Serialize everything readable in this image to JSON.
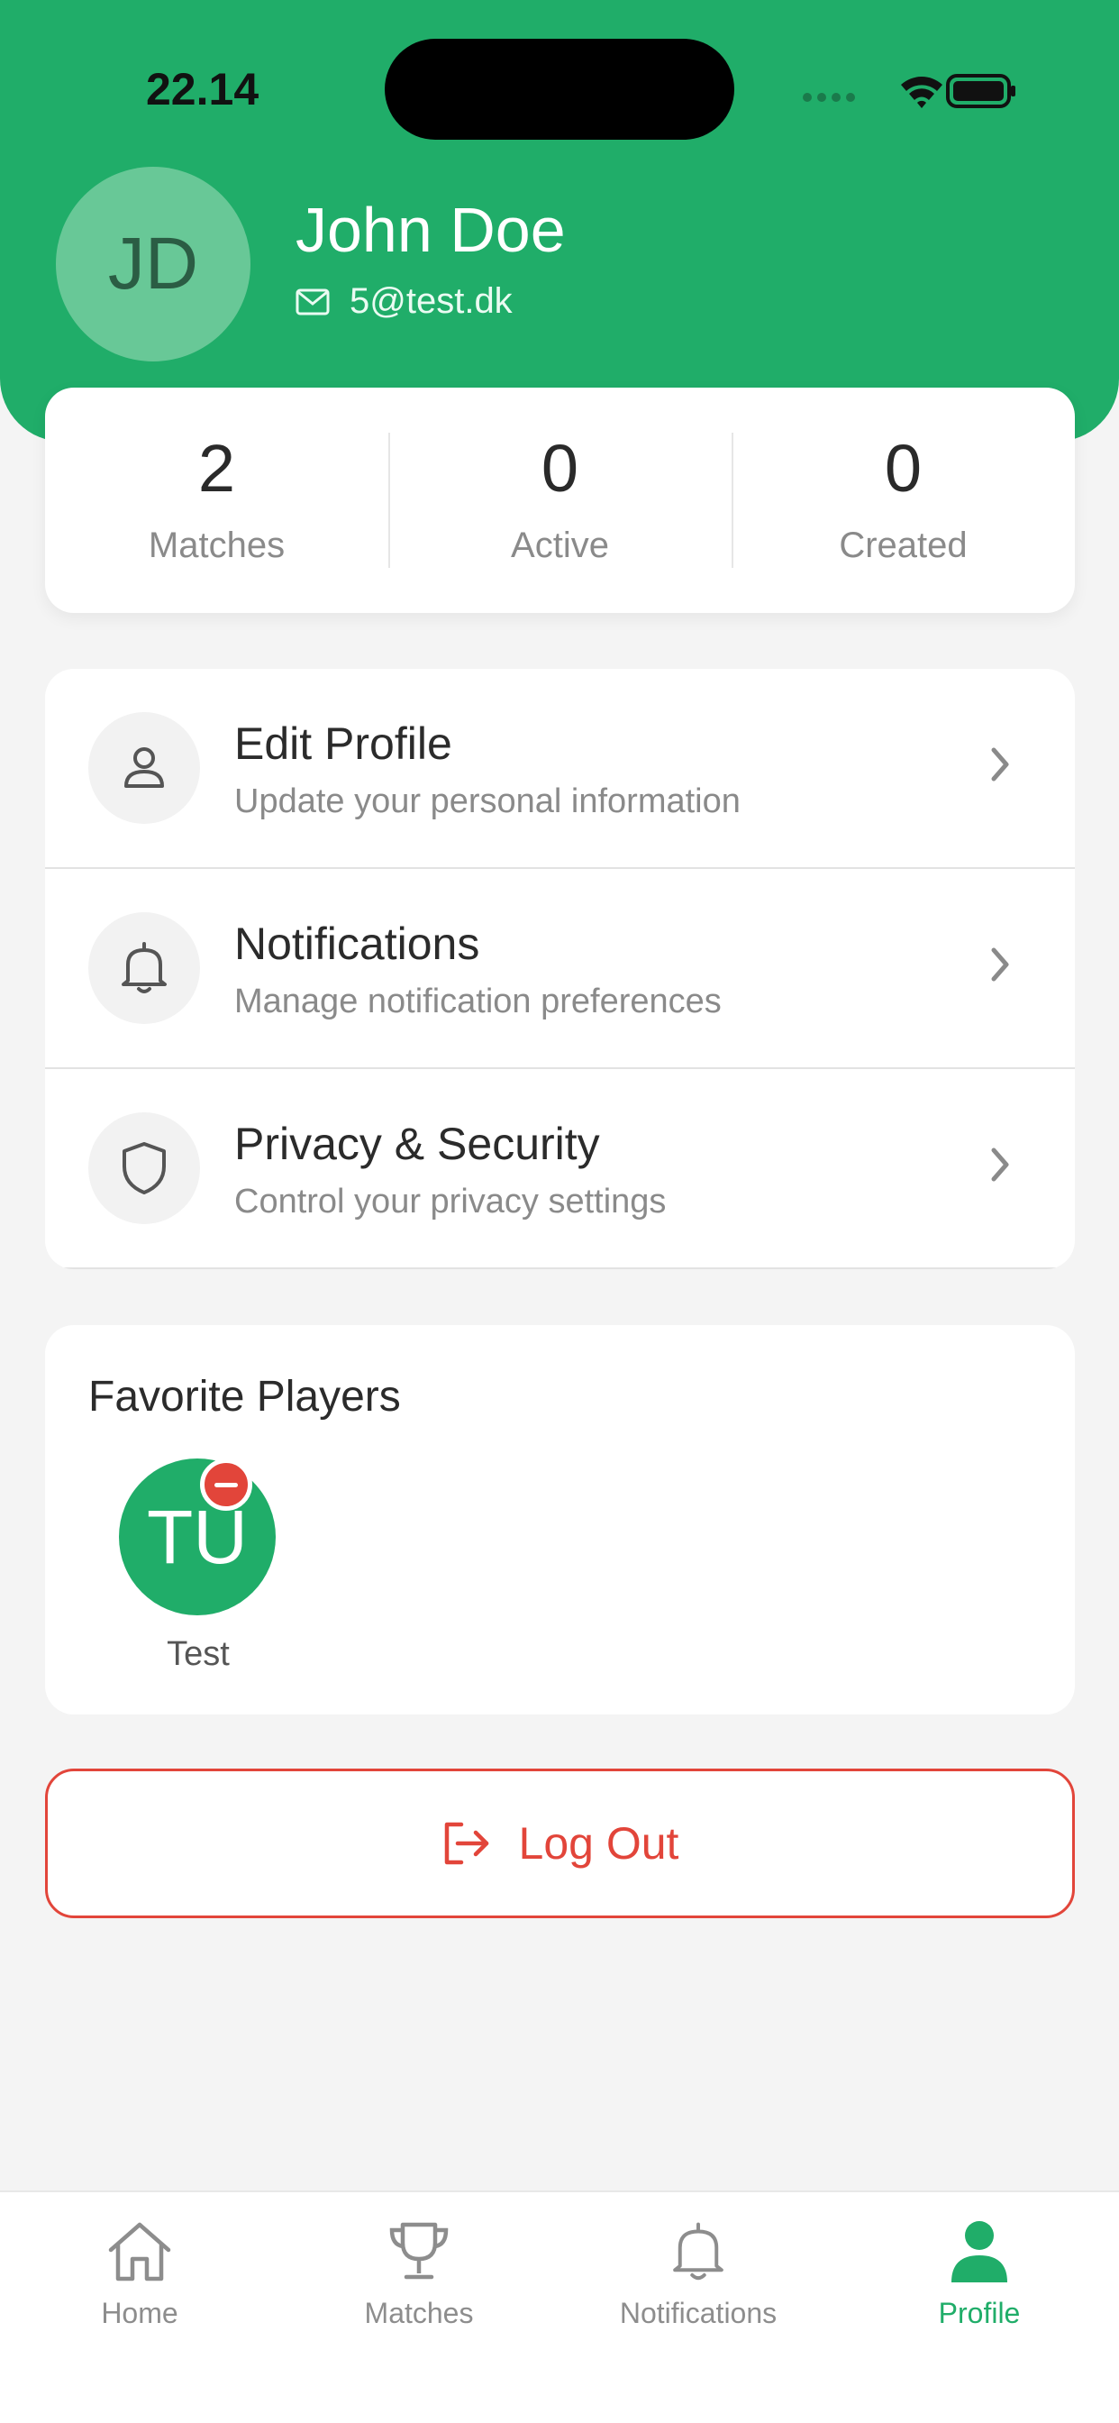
{
  "status_bar": {
    "time": "22.14"
  },
  "profile": {
    "initials": "JD",
    "name": "John Doe",
    "email": "5@test.dk"
  },
  "stats": [
    {
      "value": "2",
      "label": "Matches"
    },
    {
      "value": "0",
      "label": "Active"
    },
    {
      "value": "0",
      "label": "Created"
    }
  ],
  "menu": [
    {
      "icon": "user-icon",
      "title": "Edit Profile",
      "subtitle": "Update your personal information"
    },
    {
      "icon": "bell-icon",
      "title": "Notifications",
      "subtitle": "Manage notification preferences"
    },
    {
      "icon": "shield-icon",
      "title": "Privacy & Security",
      "subtitle": "Control your privacy settings"
    }
  ],
  "favorites": {
    "title": "Favorite Players",
    "players": [
      {
        "initials": "TU",
        "name": "Test"
      }
    ]
  },
  "logout": {
    "label": "Log Out"
  },
  "tabs": [
    {
      "icon": "home-icon",
      "label": "Home"
    },
    {
      "icon": "trophy-icon",
      "label": "Matches"
    },
    {
      "icon": "bell-icon",
      "label": "Notifications"
    },
    {
      "icon": "person-icon",
      "label": "Profile",
      "active": true
    }
  ],
  "colors": {
    "brand": "#20ad69",
    "danger": "#e2453a",
    "background": "#f4f4f4"
  }
}
